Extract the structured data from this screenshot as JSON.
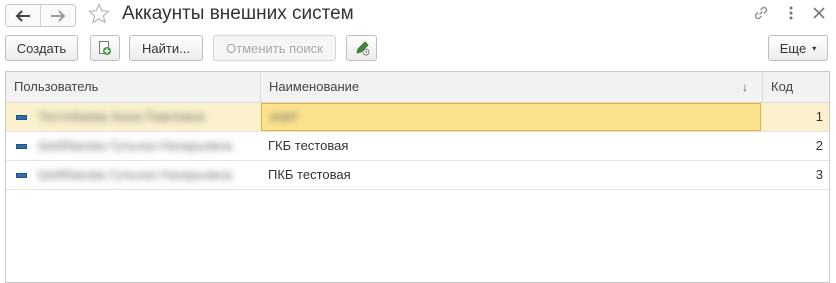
{
  "window": {
    "title": "Аккаунты внешних систем",
    "icons": [
      "back-arrow-icon",
      "forward-arrow-icon",
      "star-icon",
      "link-icon",
      "more-vertical-icon",
      "close-icon"
    ]
  },
  "toolbar": {
    "create_label": "Создать",
    "find_label": "Найти...",
    "cancel_search_label": "Отменить поиск",
    "more_label": "Еще",
    "more_caret": "▾"
  },
  "table": {
    "columns": [
      "Пользователь",
      "Наименование",
      "Код"
    ],
    "sort_indicator": "↓",
    "rows": [
      {
        "user": "Тестобаева Анна Павловна",
        "name": "ИФР",
        "code": "1",
        "selected": true
      },
      {
        "user": "Шейбакова Гульназ Назарьевна",
        "name": "ГКБ тестовая",
        "code": "2",
        "selected": false
      },
      {
        "user": "Шейбакова Гульназ Назарьевна",
        "name": "ПКБ тестовая",
        "code": "3",
        "selected": false
      }
    ]
  },
  "colors": {
    "selected_row": "#fbf1cc",
    "selected_cell": "#fbe38e",
    "row_icon": "#2f6fae"
  }
}
